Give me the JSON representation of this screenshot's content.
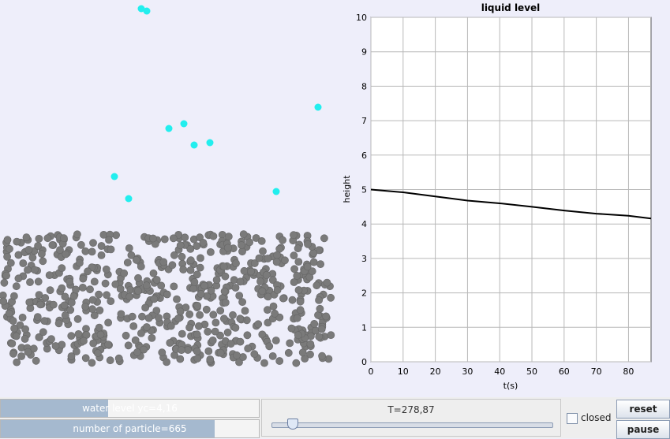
{
  "simulation": {
    "liquid_particle_color": "#7a7a7a",
    "vapor_particle_color": "#22eeee",
    "background_color": "#eeeefa"
  },
  "chart_data": {
    "type": "line",
    "title": "liquid level",
    "xlabel": "t(s)",
    "ylabel": "height",
    "xlim": [
      0,
      87
    ],
    "ylim": [
      0,
      10
    ],
    "x_ticks": [
      "0",
      "10",
      "20",
      "30",
      "40",
      "50",
      "60",
      "70",
      "80"
    ],
    "y_ticks": [
      "0",
      "1",
      "2",
      "3",
      "4",
      "5",
      "6",
      "7",
      "8",
      "9",
      "10"
    ],
    "grid": true,
    "series": [
      {
        "x": [
          0,
          10,
          20,
          30,
          40,
          50,
          60,
          70,
          80,
          87
        ],
        "values": [
          5.0,
          4.92,
          4.8,
          4.68,
          4.6,
          4.5,
          4.39,
          4.3,
          4.24,
          4.16
        ]
      }
    ]
  },
  "controls": {
    "water_level": {
      "label": "water level yc=4,16",
      "fraction": 0.416
    },
    "particles": {
      "label": "number of particle=665",
      "fraction": 0.83
    },
    "time_slider": {
      "label": "T=278,87",
      "fraction": 0.06
    },
    "closed_checkbox": {
      "label": "closed",
      "checked": false
    },
    "reset_button": "reset",
    "pause_button": "pause"
  }
}
